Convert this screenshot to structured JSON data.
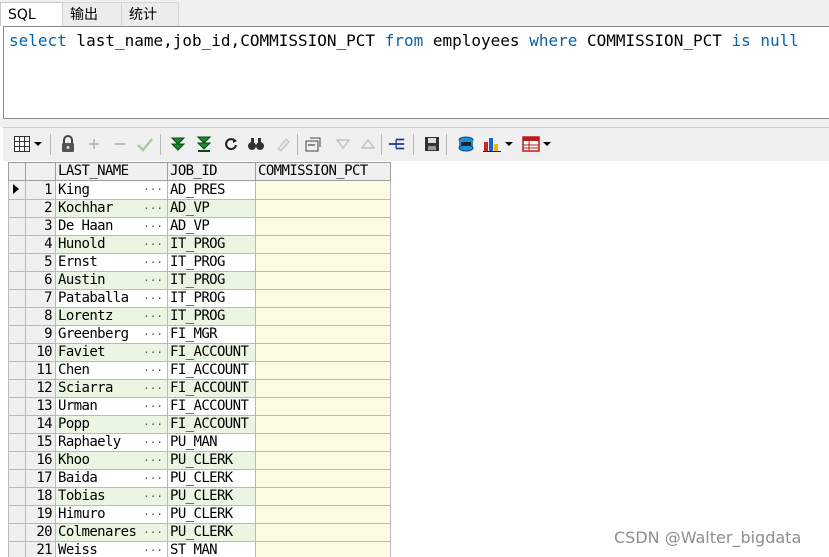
{
  "tabs": [
    {
      "label": "SQL",
      "active": true
    },
    {
      "label": "输出",
      "active": false
    },
    {
      "label": "统计",
      "active": false
    }
  ],
  "editor": {
    "tokens": [
      {
        "text": "select",
        "kw": true
      },
      {
        "text": " last_name,job_id,COMMISSION_PCT ",
        "kw": false
      },
      {
        "text": "from",
        "kw": true
      },
      {
        "text": " employees ",
        "kw": false
      },
      {
        "text": "where",
        "kw": true
      },
      {
        "text": " COMMISSION_PCT ",
        "kw": false
      },
      {
        "text": "is",
        "kw": true
      },
      {
        "text": " ",
        "kw": false
      },
      {
        "text": "null",
        "kw": true
      }
    ]
  },
  "toolbar": {
    "icons": [
      "grid-select-icon",
      "lock-icon",
      "add-row-icon",
      "delete-row-icon",
      "post-check-icon",
      "fetch-next-icon",
      "fetch-all-icon",
      "refresh-icon",
      "find-icon",
      "clear-icon",
      "single-record-icon",
      "filter-down-icon",
      "filter-up-icon",
      "query-by-example-icon",
      "save-icon",
      "export-icon",
      "chart-icon",
      "table-icon"
    ]
  },
  "grid": {
    "columns": [
      "LAST_NAME",
      "JOB_ID",
      "COMMISSION_PCT"
    ],
    "rows": [
      {
        "n": "1",
        "last_name": "King",
        "job_id": "AD_PRES",
        "commission_pct": ""
      },
      {
        "n": "2",
        "last_name": "Kochhar",
        "job_id": "AD_VP",
        "commission_pct": ""
      },
      {
        "n": "3",
        "last_name": "De Haan",
        "job_id": "AD_VP",
        "commission_pct": ""
      },
      {
        "n": "4",
        "last_name": "Hunold",
        "job_id": "IT_PROG",
        "commission_pct": ""
      },
      {
        "n": "5",
        "last_name": "Ernst",
        "job_id": "IT_PROG",
        "commission_pct": ""
      },
      {
        "n": "6",
        "last_name": "Austin",
        "job_id": "IT_PROG",
        "commission_pct": ""
      },
      {
        "n": "7",
        "last_name": "Pataballa",
        "job_id": "IT_PROG",
        "commission_pct": ""
      },
      {
        "n": "8",
        "last_name": "Lorentz",
        "job_id": "IT_PROG",
        "commission_pct": ""
      },
      {
        "n": "9",
        "last_name": "Greenberg",
        "job_id": "FI_MGR",
        "commission_pct": ""
      },
      {
        "n": "10",
        "last_name": "Faviet",
        "job_id": "FI_ACCOUNT",
        "commission_pct": ""
      },
      {
        "n": "11",
        "last_name": "Chen",
        "job_id": "FI_ACCOUNT",
        "commission_pct": ""
      },
      {
        "n": "12",
        "last_name": "Sciarra",
        "job_id": "FI_ACCOUNT",
        "commission_pct": ""
      },
      {
        "n": "13",
        "last_name": "Urman",
        "job_id": "FI_ACCOUNT",
        "commission_pct": ""
      },
      {
        "n": "14",
        "last_name": "Popp",
        "job_id": "FI_ACCOUNT",
        "commission_pct": ""
      },
      {
        "n": "15",
        "last_name": "Raphaely",
        "job_id": "PU_MAN",
        "commission_pct": ""
      },
      {
        "n": "16",
        "last_name": "Khoo",
        "job_id": "PU_CLERK",
        "commission_pct": ""
      },
      {
        "n": "17",
        "last_name": "Baida",
        "job_id": "PU_CLERK",
        "commission_pct": ""
      },
      {
        "n": "18",
        "last_name": "Tobias",
        "job_id": "PU_CLERK",
        "commission_pct": ""
      },
      {
        "n": "19",
        "last_name": "Himuro",
        "job_id": "PU_CLERK",
        "commission_pct": ""
      },
      {
        "n": "20",
        "last_name": "Colmenares",
        "job_id": "PU_CLERK",
        "commission_pct": ""
      },
      {
        "n": "21",
        "last_name": "Weiss",
        "job_id": "ST_MAN",
        "commission_pct": ""
      }
    ],
    "ellipsis": "···"
  },
  "watermark": "CSDN @Walter_bigdata",
  "colors": {
    "keyword": "#0a63a8",
    "even_row": "#eaf6e2",
    "null_cell": "#fcfce2"
  }
}
